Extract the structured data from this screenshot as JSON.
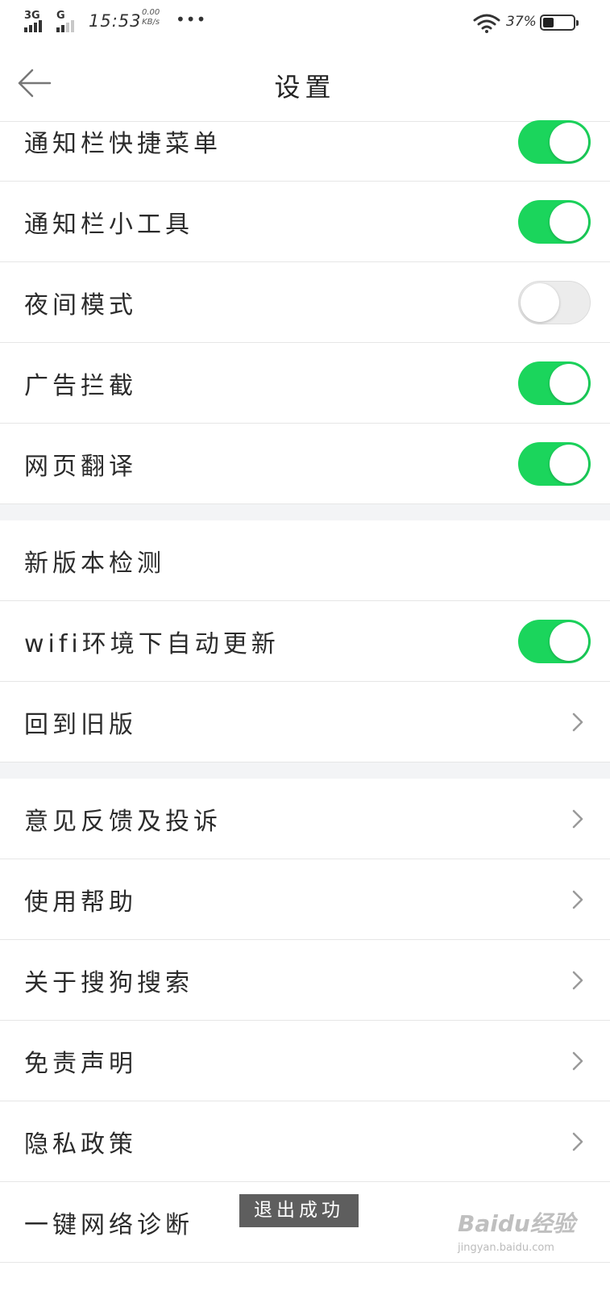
{
  "status_bar": {
    "network_1": "3G",
    "network_2": "G",
    "time": "15:53",
    "speed_value": "0.00",
    "speed_unit": "KB/s",
    "more": "•••",
    "battery_percent": "37%",
    "battery_level": 0.37
  },
  "header": {
    "back_icon": "arrow-left-icon",
    "title": "设置"
  },
  "sections": [
    {
      "items": [
        {
          "label": "通知栏快捷菜单",
          "control": "toggle",
          "on": true
        },
        {
          "label": "通知栏小工具",
          "control": "toggle",
          "on": true
        },
        {
          "label": "夜间模式",
          "control": "toggle",
          "on": false
        },
        {
          "label": "广告拦截",
          "control": "toggle",
          "on": true
        },
        {
          "label": "网页翻译",
          "control": "toggle",
          "on": true
        }
      ]
    },
    {
      "items": [
        {
          "label": "新版本检测",
          "control": "none"
        },
        {
          "label": "wifi环境下自动更新",
          "control": "toggle",
          "on": true
        },
        {
          "label": "回到旧版",
          "control": "chevron"
        }
      ]
    },
    {
      "items": [
        {
          "label": "意见反馈及投诉",
          "control": "chevron"
        },
        {
          "label": "使用帮助",
          "control": "chevron"
        },
        {
          "label": "关于搜狗搜索",
          "control": "chevron"
        },
        {
          "label": "免责声明",
          "control": "chevron"
        },
        {
          "label": "隐私政策",
          "control": "chevron"
        },
        {
          "label": "一键网络诊断",
          "control": "none"
        }
      ]
    }
  ],
  "toast": "退出成功",
  "watermark": {
    "logo": "Baidu经验",
    "url": "jingyan.baidu.com"
  },
  "colors": {
    "toggle_on": "#1bd55c",
    "toggle_off": "#ececec",
    "section_gap": "#f3f4f6",
    "divider": "#e6e6e6"
  }
}
